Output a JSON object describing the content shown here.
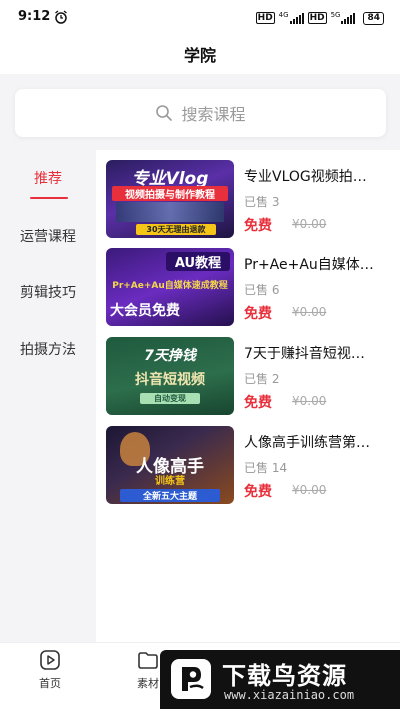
{
  "status_bar": {
    "time": "9:12",
    "hd1": "HD",
    "net1": "4G",
    "hd2": "HD",
    "net2": "5G",
    "battery": "84"
  },
  "header": {
    "title": "学院"
  },
  "search": {
    "placeholder": "搜索课程"
  },
  "sidebar": {
    "items": [
      {
        "label": "推荐",
        "active": true
      },
      {
        "label": "运营课程",
        "active": false
      },
      {
        "label": "剪辑技巧",
        "active": false
      },
      {
        "label": "拍摄方法",
        "active": false
      }
    ]
  },
  "courses": [
    {
      "title": "专业VLOG视频拍…",
      "sold": "已售 3",
      "price": "免费",
      "original_price": "¥0.00",
      "thumb": {
        "line1": "专业Vlog",
        "line2": "视频拍摄与制作教程",
        "line3": "30天无理由退款"
      }
    },
    {
      "title": "Pr+Ae+Au自媒体…",
      "sold": "已售 6",
      "price": "免费",
      "original_price": "¥0.00",
      "thumb": {
        "line1": "AU教程",
        "line2": "Pr+Ae+Au自媒体速成教程",
        "line3": "大会员免费"
      }
    },
    {
      "title": "7天于赚抖音短视…",
      "sold": "已售 2",
      "price": "免费",
      "original_price": "¥0.00",
      "thumb": {
        "line1": "7天挣钱",
        "line2": "抖音短视频",
        "line3": "自动变现"
      }
    },
    {
      "title": "人像高手训练营第…",
      "sold": "已售 14",
      "price": "免费",
      "original_price": "¥0.00",
      "thumb": {
        "line1": "人像高手",
        "line2": "训练营",
        "line3": "全新五大主题"
      }
    }
  ],
  "bottom_nav": {
    "items": [
      {
        "label": "首页",
        "icon": "play-icon"
      },
      {
        "label": "素材",
        "icon": "folder-icon"
      }
    ]
  },
  "watermark": {
    "title": "下载鸟资源",
    "url": "www.xiazainiao.com"
  },
  "colors": {
    "accent": "#e8303c",
    "background": "#f4f4f6"
  }
}
